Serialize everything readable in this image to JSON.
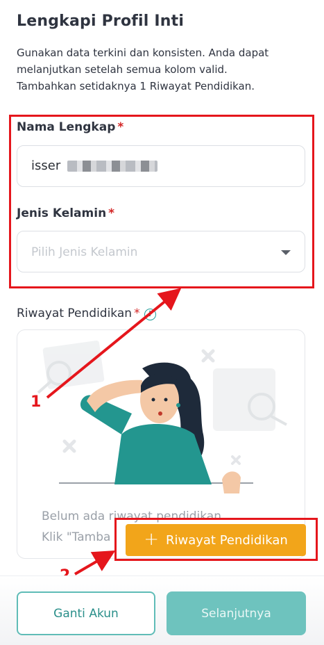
{
  "page": {
    "title": "Lengkapi Profil Inti",
    "description_lines": [
      "Gunakan data terkini dan konsisten. Anda dapat",
      "melanjutkan setelah semua kolom valid.",
      "Tambahkan setidaknya 1 Riwayat Pendidikan."
    ]
  },
  "form": {
    "name_label": "Nama Lengkap",
    "name_value": "isser",
    "gender_label": "Jenis Kelamin",
    "gender_placeholder": "Pilih Jenis Kelamin",
    "required_mark": "*"
  },
  "education": {
    "label": "Riwayat Pendidikan",
    "info_icon": "i",
    "empty_lines": [
      "Belum ada riwayat pendidikan",
      "Klik \"Tamba"
    ],
    "add_button_label": "Riwayat Pendidikan",
    "add_button_icon": "+"
  },
  "footer": {
    "change_account_label": "Ganti Akun",
    "next_label": "Selanjutnya"
  },
  "annotations": {
    "marker_1": "1",
    "marker_2": "2"
  },
  "colors": {
    "accent_teal": "#1f9d99",
    "add_button": "#f2a51a",
    "annotation_red": "#e5161c"
  }
}
